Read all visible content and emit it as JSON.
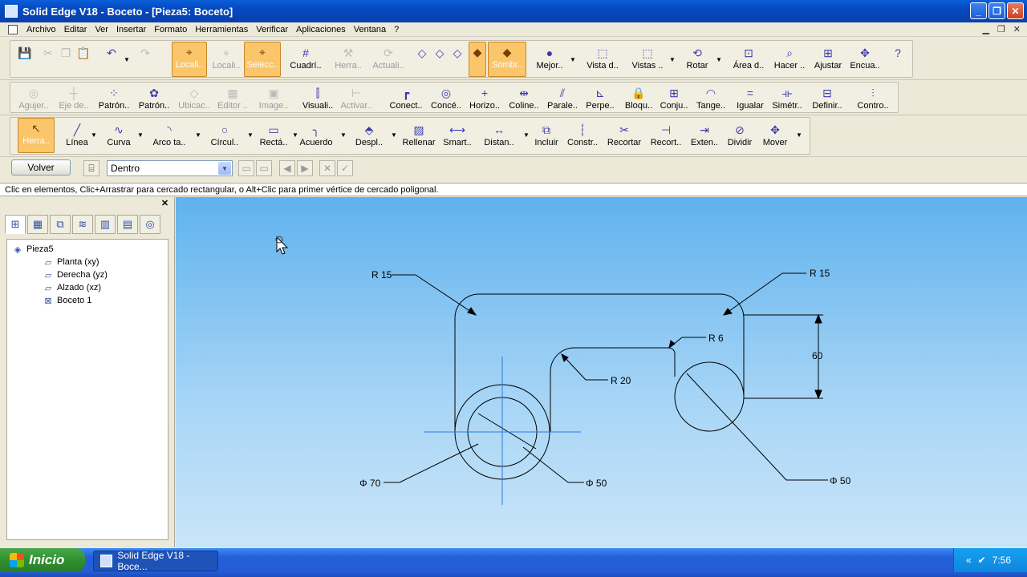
{
  "window": {
    "title": "Solid Edge V18 - Boceto - [Pieza5: Boceto]",
    "buttons": [
      "minimize-icon",
      "restore-icon",
      "close-icon"
    ]
  },
  "menu": [
    "Archivo",
    "Editar",
    "Ver",
    "Insertar",
    "Formato",
    "Herramientas",
    "Verificar",
    "Aplicaciones",
    "Ventana",
    "?"
  ],
  "toolbar1": [
    {
      "label": "",
      "icon": "save-icon",
      "state": "normal"
    },
    {
      "label": "",
      "icon": "cut-icon",
      "state": "disabled"
    },
    {
      "label": "",
      "icon": "copy-icon",
      "state": "disabled"
    },
    {
      "label": "",
      "icon": "paste-icon",
      "state": "disabled"
    },
    {
      "label": "",
      "icon": "undo-icon",
      "state": "normal"
    },
    {
      "label": "",
      "icon": "redo-icon",
      "state": "disabled"
    },
    {
      "label": "Locali..",
      "icon": "locate-icon",
      "state": "active"
    },
    {
      "label": "Locali..",
      "icon": "locate-icon",
      "state": "disabled"
    },
    {
      "label": "Selecc..",
      "icon": "select-icon",
      "state": "active"
    },
    {
      "label": "Cuadrí..",
      "icon": "grid-icon",
      "state": "normal"
    },
    {
      "label": "Herra..",
      "icon": "tool-icon",
      "state": "disabled"
    },
    {
      "label": "Actuali..",
      "icon": "update-icon",
      "state": "disabled"
    },
    {
      "label": "",
      "icon": "cube-icon",
      "state": "normal"
    },
    {
      "label": "",
      "icon": "cube-icon",
      "state": "normal"
    },
    {
      "label": "",
      "icon": "cube-icon",
      "state": "normal"
    },
    {
      "label": "",
      "icon": "shaded-cube-icon",
      "state": "active"
    },
    {
      "label": "Sombr..",
      "icon": "shaded-cube-icon",
      "state": "active"
    },
    {
      "label": "Mejor..",
      "icon": "sphere-icon",
      "state": "normal"
    },
    {
      "label": "Vista d..",
      "icon": "view-icon",
      "state": "normal"
    },
    {
      "label": "Vistas ..",
      "icon": "views-icon",
      "state": "normal"
    },
    {
      "label": "Rotar",
      "icon": "rotate-icon",
      "state": "normal"
    },
    {
      "label": "Área d..",
      "icon": "zoom-area-icon",
      "state": "normal"
    },
    {
      "label": "Hacer ..",
      "icon": "zoom-icon",
      "state": "normal"
    },
    {
      "label": "Ajustar",
      "icon": "fit-icon",
      "state": "normal"
    },
    {
      "label": "Encua..",
      "icon": "pan-icon",
      "state": "normal"
    },
    {
      "label": "",
      "icon": "help-icon",
      "state": "normal"
    }
  ],
  "toolbar2": [
    {
      "label": "Agujer..",
      "icon": "hole-icon",
      "state": "disabled"
    },
    {
      "label": "Eje de..",
      "icon": "axis-icon",
      "state": "disabled"
    },
    {
      "label": "Patrón..",
      "icon": "pattern-icon",
      "state": "normal"
    },
    {
      "label": "Patrón..",
      "icon": "pattern-circular-icon",
      "state": "normal"
    },
    {
      "label": "Ubicac..",
      "icon": "location-icon",
      "state": "disabled"
    },
    {
      "label": "Editor ..",
      "icon": "editor-icon",
      "state": "disabled"
    },
    {
      "label": "Image..",
      "icon": "image-icon",
      "state": "disabled"
    },
    {
      "label": "Visuali..",
      "icon": "display-icon",
      "state": "normal"
    },
    {
      "label": "Activar..",
      "icon": "activate-icon",
      "state": "disabled"
    },
    {
      "label": "Conect..",
      "icon": "connect-icon",
      "state": "normal"
    },
    {
      "label": "Concé..",
      "icon": "concentric-icon",
      "state": "normal"
    },
    {
      "label": "Horizo..",
      "icon": "horizontal-icon",
      "state": "normal"
    },
    {
      "label": "Coline..",
      "icon": "collinear-icon",
      "state": "normal"
    },
    {
      "label": "Parale..",
      "icon": "parallel-icon",
      "state": "normal"
    },
    {
      "label": "Perpe..",
      "icon": "perpendicular-icon",
      "state": "normal"
    },
    {
      "label": "Bloqu..",
      "icon": "lock-icon",
      "state": "normal"
    },
    {
      "label": "Conju..",
      "icon": "rigid-set-icon",
      "state": "normal"
    },
    {
      "label": "Tange..",
      "icon": "tangent-icon",
      "state": "normal"
    },
    {
      "label": "Igualar",
      "icon": "equal-icon",
      "state": "normal"
    },
    {
      "label": "Simétr..",
      "icon": "symmetric-icon",
      "state": "normal"
    },
    {
      "label": "Definir..",
      "icon": "define-icon",
      "state": "normal"
    },
    {
      "label": "Contro..",
      "icon": "control-icon",
      "state": "normal"
    }
  ],
  "toolbar3": [
    {
      "label": "Herra..",
      "icon": "pointer-icon",
      "state": "active"
    },
    {
      "label": "Línea",
      "icon": "line-icon",
      "state": "normal"
    },
    {
      "label": "Curva",
      "icon": "curve-icon",
      "state": "normal"
    },
    {
      "label": "Arco ta..",
      "icon": "arc-icon",
      "state": "normal"
    },
    {
      "label": "Círcul..",
      "icon": "circle-icon",
      "state": "normal"
    },
    {
      "label": "Rectá..",
      "icon": "rectangle-icon",
      "state": "normal"
    },
    {
      "label": "Acuerdo",
      "icon": "fillet-icon",
      "state": "normal"
    },
    {
      "label": "Despl..",
      "icon": "offset-icon",
      "state": "normal"
    },
    {
      "label": "Rellenar",
      "icon": "fill-icon",
      "state": "normal"
    },
    {
      "label": "Smart..",
      "icon": "smart-dimension-icon",
      "state": "normal"
    },
    {
      "label": "Distan..",
      "icon": "distance-icon",
      "state": "normal"
    },
    {
      "label": "Incluir",
      "icon": "include-icon",
      "state": "normal"
    },
    {
      "label": "Constr..",
      "icon": "construction-icon",
      "state": "normal"
    },
    {
      "label": "Recortar",
      "icon": "trim-icon",
      "state": "normal"
    },
    {
      "label": "Recort..",
      "icon": "trim-corner-icon",
      "state": "normal"
    },
    {
      "label": "Exten..",
      "icon": "extend-icon",
      "state": "normal"
    },
    {
      "label": "Dividir",
      "icon": "split-icon",
      "state": "normal"
    },
    {
      "label": "Mover",
      "icon": "move-icon",
      "state": "normal"
    }
  ],
  "ribbon": {
    "back_label": "Volver",
    "select_value": "Dentro"
  },
  "prompt": "Clic en elementos, Clic+Arrastrar para cercado rectangular, o Alt+Clic para primer vértice de cercado poligonal.",
  "tree": {
    "root": "Pieza5",
    "children": [
      "Planta (xy)",
      "Derecha (yz)",
      "Alzado (xz)",
      "Boceto 1"
    ]
  },
  "sketch": {
    "dimensions": [
      "R 15",
      "R 15",
      "R 6",
      "R 20",
      "60",
      "Φ 70",
      "Φ 50",
      "Φ 50"
    ]
  },
  "taskbar": {
    "start_label": "Inicio",
    "task_label": "Solid Edge V18 - Boce...",
    "clock": "7:56"
  }
}
